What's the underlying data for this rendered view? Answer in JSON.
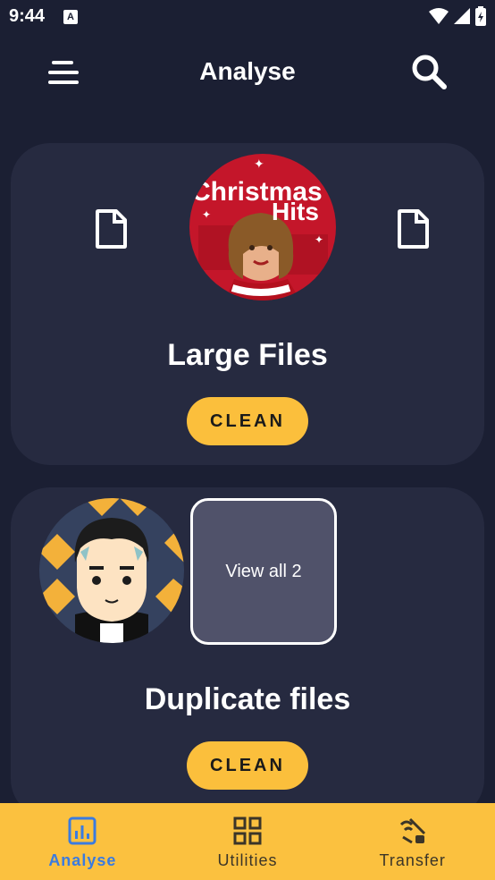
{
  "status_bar": {
    "time": "9:44",
    "notification_icon": "a-icon"
  },
  "app_bar": {
    "title": "Analyse"
  },
  "cards": [
    {
      "title": "Large Files",
      "button": "CLEAN",
      "thumbnail": {
        "line1": "Christmas",
        "line2": "Hits"
      }
    },
    {
      "title": "Duplicate files",
      "button": "CLEAN",
      "view_all": "View all 2"
    }
  ],
  "bottom_nav": {
    "items": [
      {
        "label": "Analyse",
        "icon": "analytics-icon",
        "active": true
      },
      {
        "label": "Utilities",
        "icon": "grid-icon",
        "active": false
      },
      {
        "label": "Transfer",
        "icon": "transfer-icon",
        "active": false
      }
    ]
  },
  "colors": {
    "background": "#1b1f33",
    "card": "#262a40",
    "accent": "#fbbf3c",
    "active_nav": "#3a7be0"
  }
}
